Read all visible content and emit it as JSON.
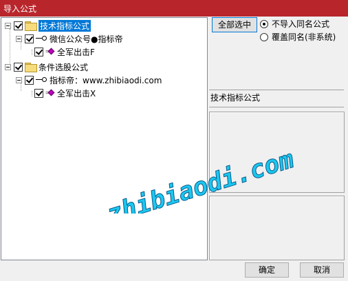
{
  "window": {
    "title": "导入公式"
  },
  "tree": {
    "items": [
      {
        "label": "技术指标公式",
        "selected": true
      },
      {
        "label": "微信公众号●指标帝"
      },
      {
        "label": "全军出击F"
      },
      {
        "label": "条件选股公式"
      },
      {
        "label": "指标帝：www.zhibiaodi.com"
      },
      {
        "label": "全军出击X"
      }
    ]
  },
  "buttons": {
    "select_all": "全部选中",
    "ok": "确定",
    "cancel": "取消"
  },
  "options": {
    "skip_same_name": "不导入同名公式",
    "overwrite_same_name": "覆盖同名(非系统)",
    "selected": "skip_same_name"
  },
  "info": {
    "label": "技术指标公式"
  },
  "watermark": {
    "text": "www.zhibiaodi.com"
  },
  "colors": {
    "titlebar": "#b8262c",
    "selection": "#0078d7",
    "watermark": "#1ac8f0"
  }
}
